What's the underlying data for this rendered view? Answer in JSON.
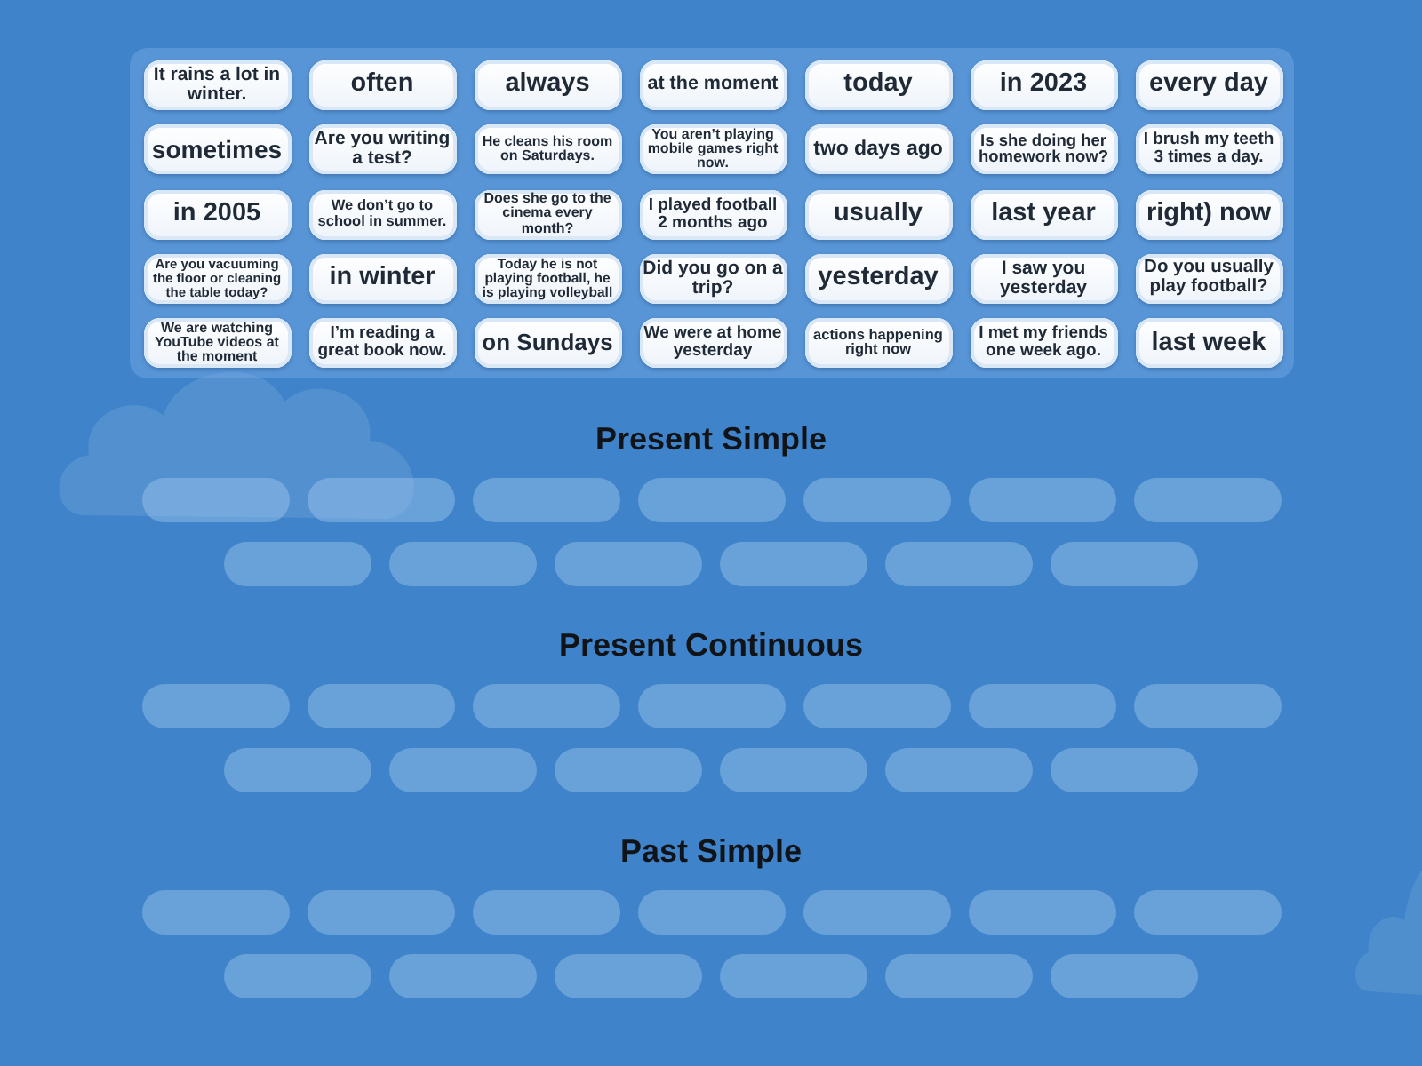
{
  "cards": [
    "It rains a lot in winter.",
    "often",
    "always",
    "at the moment",
    "today",
    "in 2023",
    "every day",
    "sometimes",
    "Are you writing a test?",
    "He cleans his room on Saturdays.",
    "You aren’t playing mobile games right now.",
    "two days ago",
    "Is she doing her homework now?",
    "I brush my teeth 3 times a day.",
    "in 2005",
    "We don’t go to school in summer.",
    "Does she go to the cinema every month?",
    "I played football 2 months ago",
    "usually",
    "last year",
    "right) now",
    "Are you vacuuming the floor or cleaning the table today?",
    "in winter",
    "Today he is not playing football, he is playing volleyball",
    "Did you go on a trip?",
    "yesterday",
    "I saw you yesterday",
    "Do you usually play football?",
    "We are watching YouTube videos at the moment",
    "I’m reading a great book now.",
    "on Sundays",
    "We were at home yesterday",
    "actions happening right now",
    "I met my friends one week ago.",
    "last week"
  ],
  "groups": [
    {
      "title": "Present Simple"
    },
    {
      "title": "Present Continuous"
    },
    {
      "title": "Past Simple"
    }
  ]
}
